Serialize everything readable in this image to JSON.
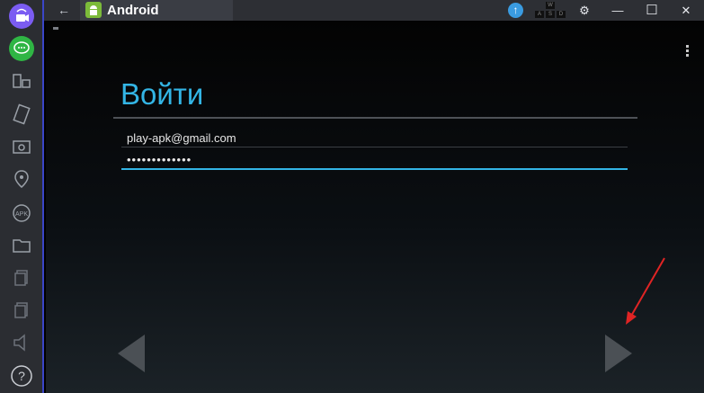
{
  "topbar": {
    "back_icon": "←",
    "tab_title": "Android",
    "upload_icon": "↑",
    "keyboard_keys": [
      "W",
      "A",
      "S",
      "D"
    ],
    "settings_icon": "⚙",
    "minimize_icon": "—",
    "maximize_icon": "☐",
    "close_icon": "✕"
  },
  "sidebar": {
    "items": [
      {
        "icon": "video-camera-icon",
        "accent": "#7b5cf2"
      },
      {
        "icon": "chat-icon",
        "accent": "#2fb544"
      },
      {
        "icon": "screens-icon"
      },
      {
        "icon": "shake-icon"
      },
      {
        "icon": "camera-icon"
      },
      {
        "icon": "location-pin-icon"
      },
      {
        "icon": "apk-icon",
        "label": "APK"
      },
      {
        "icon": "folder-icon"
      },
      {
        "icon": "copy-icon"
      },
      {
        "icon": "copy-icon-2"
      },
      {
        "icon": "speaker-icon"
      },
      {
        "icon": "help-icon",
        "label": "?"
      }
    ]
  },
  "login": {
    "title": "Войти",
    "email_value": "play-apk@gmail.com",
    "password_value": "•••••••••••••"
  },
  "colors": {
    "accent": "#33b5e5",
    "sidebar_border": "#3a46c8"
  }
}
